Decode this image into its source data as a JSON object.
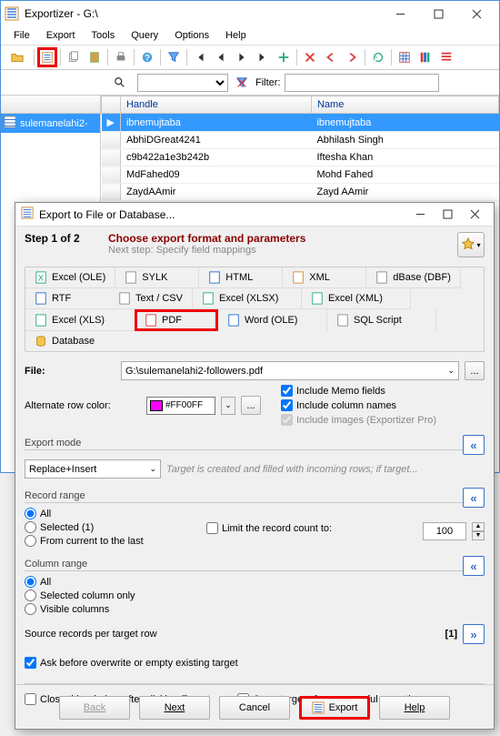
{
  "main": {
    "title": "Exportizer - G:\\",
    "menu": [
      "File",
      "Export",
      "Tools",
      "Query",
      "Options",
      "Help"
    ],
    "filter_label": "Filter:",
    "sidebar_item": "sulemanelahi2-",
    "columns": [
      "Handle",
      "Name"
    ],
    "rows": [
      {
        "handle": "ibnemujtaba",
        "name": "ibnemujtaba",
        "sel": true
      },
      {
        "handle": "AbhiDGreat4241",
        "name": "Abhilash Singh"
      },
      {
        "handle": "c9b422a1e3b242b",
        "name": "Iftesha Khan"
      },
      {
        "handle": "MdFahed09",
        "name": "Mohd Fahed"
      },
      {
        "handle": "ZaydAAmir",
        "name": "Zayd AAmir"
      }
    ]
  },
  "dlg": {
    "title": "Export to File or Database...",
    "step": "Step 1 of 2",
    "heading": "Choose export format and parameters",
    "subheading": "Next step: Specify field mappings",
    "tabs": [
      "Excel (OLE)",
      "SYLK",
      "HTML",
      "XML",
      "dBase (DBF)",
      "RTF",
      "Text / CSV",
      "Excel (XLSX)",
      "Excel (XML)",
      "Excel (XLS)",
      "PDF",
      "Word (OLE)",
      "SQL Script",
      "Database"
    ],
    "file_label": "File:",
    "file_value": "G:\\sulemanelahi2-followers.pdf",
    "altcolor_label": "Alternate row color:",
    "altcolor_value": "#FF00FF",
    "cb_memo": "Include Memo fields",
    "cb_cols": "Include column names",
    "cb_images": "Include images (Exportizer Pro)",
    "export_mode_label": "Export mode",
    "export_mode_value": "Replace+Insert",
    "export_mode_hint": "Target is created and filled with incoming rows; if target...",
    "record_range_label": "Record range",
    "rr_all": "All",
    "rr_sel": "Selected (1)",
    "rr_cur": "From current to the last",
    "rr_limit": "Limit the record count to:",
    "rr_limit_val": "100",
    "col_range_label": "Column range",
    "cr_all": "All",
    "cr_sel": "Selected column only",
    "cr_vis": "Visible columns",
    "src_label": "Source records per target row",
    "src_val": "[1]",
    "ask_label": "Ask before overwrite or empty existing target",
    "close_after": "Close this window after clicking Export",
    "open_after": "Open target after successful exporting",
    "btn_back": "Back",
    "btn_next": "Next",
    "btn_cancel": "Cancel",
    "btn_export": "Export",
    "btn_help": "Help"
  }
}
